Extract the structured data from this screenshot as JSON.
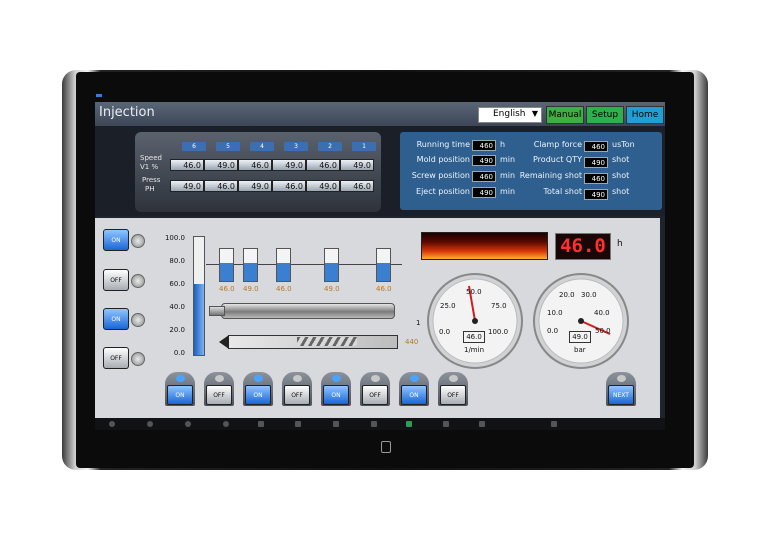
{
  "header": {
    "title": "Injection",
    "language": "English",
    "nav": [
      {
        "label": "Manual",
        "color": "#3cb043"
      },
      {
        "label": "Setup",
        "color": "#2bb24c"
      },
      {
        "label": "Home",
        "color": "#1f9fd6"
      }
    ]
  },
  "speed_press": {
    "tags": [
      "6",
      "5",
      "4",
      "3",
      "2",
      "1"
    ],
    "speed_label": "Speed",
    "speed_unit": "V1  %",
    "press_label": "Press",
    "press_unit": "PH",
    "speed_values": [
      "46.0",
      "49.0",
      "46.0",
      "49.0",
      "46.0",
      "49.0"
    ],
    "press_values": [
      "49.0",
      "46.0",
      "49.0",
      "46.0",
      "49.0",
      "46.0"
    ]
  },
  "stats": {
    "left": [
      {
        "label": "Running time",
        "value": "460",
        "unit": "h"
      },
      {
        "label": "Mold position",
        "value": "490",
        "unit": "min"
      },
      {
        "label": "Screw position",
        "value": "460",
        "unit": "min"
      },
      {
        "label": "Eject position",
        "value": "490",
        "unit": "min"
      }
    ],
    "right": [
      {
        "label": "Clamp force",
        "value": "460",
        "unit": "usTon"
      },
      {
        "label": "Product QTY",
        "value": "490",
        "unit": "shot"
      },
      {
        "label": "Remaining shot",
        "value": "460",
        "unit": "shot"
      },
      {
        "label": "Total shot",
        "value": "490",
        "unit": "shot"
      }
    ]
  },
  "side_switches": [
    "ON",
    "OFF",
    "ON",
    "OFF"
  ],
  "level_scale": [
    "100.0",
    "80.0",
    "60.0",
    "40.0",
    "20.0",
    "0.0"
  ],
  "tanks": [
    {
      "value": "46.0",
      "level": 0.55
    },
    {
      "value": "49.0",
      "level": 0.55
    },
    {
      "value": "46.0",
      "level": 0.55
    },
    {
      "value": "49.0",
      "level": 0.55
    },
    {
      "value": "46.0",
      "level": 0.55
    }
  ],
  "screw_value": "440",
  "screw_side_label": "1",
  "temperature": {
    "value": "46.0",
    "unit": "h"
  },
  "gauge1": {
    "ticks": [
      "25.0",
      "50.0",
      "75.0",
      "0.0",
      "100.0"
    ],
    "value": "46.0",
    "unit": "1/min"
  },
  "gauge2": {
    "ticks": [
      "20.0",
      "30.0",
      "10.0",
      "40.0",
      "0.0",
      "50.0"
    ],
    "value": "49.0",
    "unit": "bar"
  },
  "bottom_switches": [
    "ON",
    "OFF",
    "ON",
    "OFF",
    "ON",
    "OFF",
    "ON",
    "OFF"
  ],
  "next_button": "NEXT"
}
